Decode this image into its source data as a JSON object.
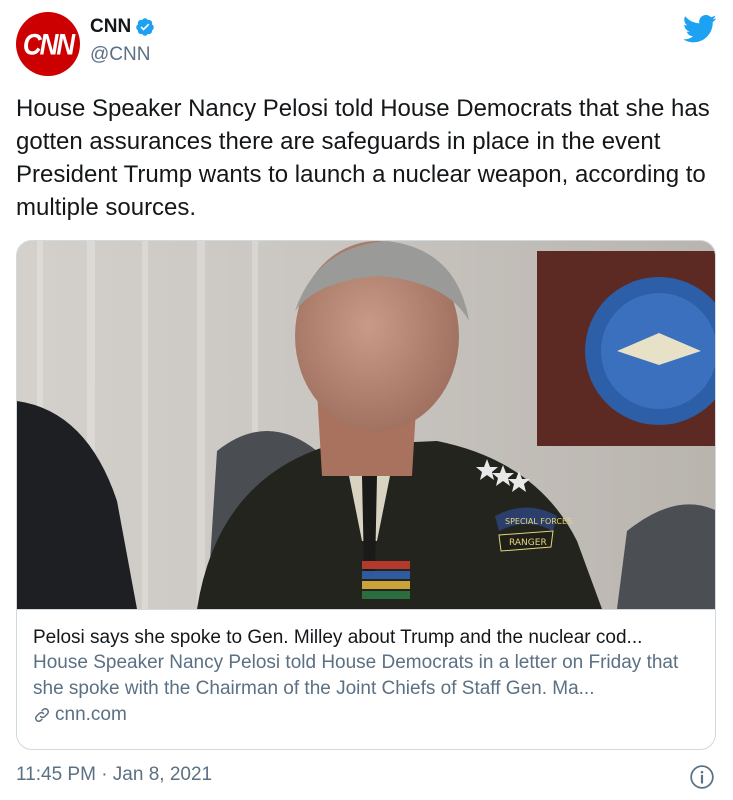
{
  "author": {
    "display_name": "CNN",
    "handle": "@CNN",
    "avatar_text": "CNN",
    "verified": true
  },
  "tweet": {
    "text": "House Speaker Nancy Pelosi told House Democrats that she has gotten assurances there are safeguards in place in the event President Trump wants to launch a nuclear weapon, according to multiple sources.",
    "timestamp": "11:45 PM · Jan 8, 2021"
  },
  "card": {
    "title": "Pelosi says she spoke to Gen. Milley about Trump and the nuclear cod...",
    "description": "House Speaker Nancy Pelosi told House Democrats in a letter on Friday that she spoke with the Chairman of the Joint Chiefs of Staff Gen. Ma...",
    "domain": "cnn.com",
    "image_badges": [
      "SPECIAL FORCES",
      "RANGER"
    ]
  },
  "colors": {
    "brand_red": "#cc0000",
    "twitter_blue": "#1da1f2",
    "secondary_text": "#5b7083"
  },
  "icons": [
    "verified-icon",
    "twitter-icon",
    "link-icon",
    "info-icon"
  ]
}
